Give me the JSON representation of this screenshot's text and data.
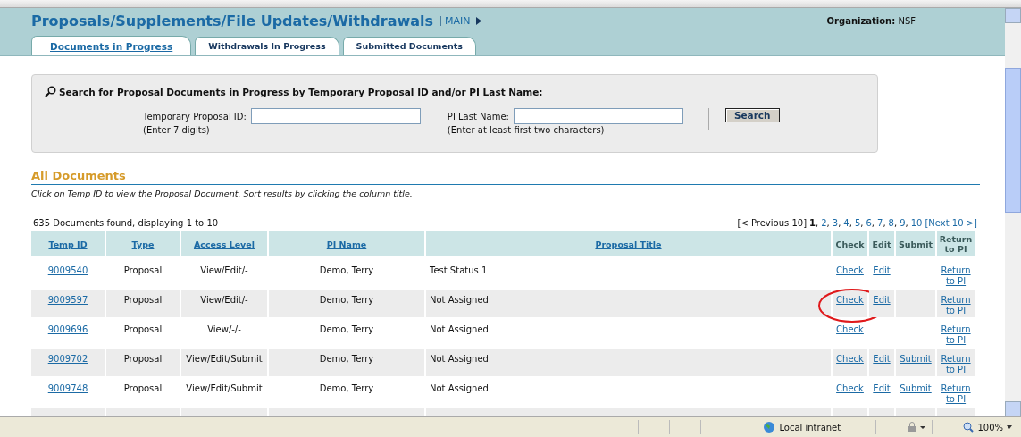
{
  "header": {
    "title": "Proposals/Supplements/File Updates/Withdrawals",
    "main_link": "MAIN",
    "organization_label": "Organization:",
    "organization": "NSF"
  },
  "tabs": [
    {
      "label": "Documents in Progress",
      "selected": true
    },
    {
      "label": "Withdrawals In Progress",
      "selected": false
    },
    {
      "label": "Submitted Documents",
      "selected": false
    }
  ],
  "search": {
    "heading": "Search for Proposal Documents in Progress by Temporary Proposal ID and/or PI Last Name:",
    "fields": [
      {
        "label": "Temporary Proposal ID:",
        "hint": "(Enter 7 digits)"
      },
      {
        "label": "PI Last Name:",
        "hint": "(Enter at least first two characters)"
      }
    ],
    "button": "Search"
  },
  "section": {
    "title": "All Documents",
    "caption": "Click on Temp ID to view the Proposal Document. Sort results by clicking the column title."
  },
  "results_count": "635 Documents found, displaying 1 to 10",
  "pagination": {
    "previous": "[< Previous 10]",
    "separator": ",",
    "pages": [
      {
        "label": "1",
        "selected": true
      },
      {
        "label": "2",
        "selected": false
      },
      {
        "label": "3",
        "selected": false
      },
      {
        "label": "4",
        "selected": false
      },
      {
        "label": "5",
        "selected": false
      },
      {
        "label": "6",
        "selected": false
      },
      {
        "label": "7",
        "selected": false
      },
      {
        "label": "8",
        "selected": false
      },
      {
        "label": "9",
        "selected": false
      },
      {
        "label": "10",
        "selected": false
      }
    ],
    "next": "[Next 10 >]"
  },
  "table": {
    "columns": [
      {
        "label": "Temp ID",
        "sortable": true
      },
      {
        "label": "Type",
        "sortable": true
      },
      {
        "label": "Access Level",
        "sortable": true
      },
      {
        "label": "PI Name",
        "sortable": true
      },
      {
        "label": "Proposal Title",
        "sortable": true
      },
      {
        "label": "Check",
        "sortable": false
      },
      {
        "label": "Edit",
        "sortable": false
      },
      {
        "label": "Submit",
        "sortable": false
      },
      {
        "label": "Return to PI",
        "sortable": false
      }
    ],
    "rows": [
      {
        "temp_id": "9009540",
        "type": "Proposal",
        "access_level": "View/Edit/-",
        "pi_name": "Demo, Terry",
        "title": "Test Status 1",
        "check": "Check",
        "edit": "Edit",
        "return": "Return to PI",
        "circled": false
      },
      {
        "temp_id": "9009597",
        "type": "Proposal",
        "access_level": "View/Edit/-",
        "pi_name": "Demo, Terry",
        "title": "Not Assigned",
        "check": "Check",
        "edit": "Edit",
        "return": "Return to PI",
        "circled": true
      },
      {
        "temp_id": "9009696",
        "type": "Proposal",
        "access_level": "View/-/-",
        "pi_name": "Demo, Terry",
        "title": "Not Assigned",
        "check": "Check",
        "return": "Return to PI",
        "circled": false
      },
      {
        "temp_id": "9009702",
        "type": "Proposal",
        "access_level": "View/Edit/Submit",
        "pi_name": "Demo, Terry",
        "title": "Not Assigned",
        "check": "Check",
        "edit": "Edit",
        "submit": "Submit",
        "return": "Return to PI",
        "circled": false
      },
      {
        "temp_id": "9009748",
        "type": "Proposal",
        "access_level": "View/Edit/Submit",
        "pi_name": "Demo, Terry",
        "title": "Not Assigned",
        "check": "Check",
        "edit": "Edit",
        "submit": "Submit",
        "return": "Return to PI",
        "circled": false
      }
    ]
  },
  "status_bar": {
    "zone": "Local intranet",
    "zoom": "100%"
  }
}
